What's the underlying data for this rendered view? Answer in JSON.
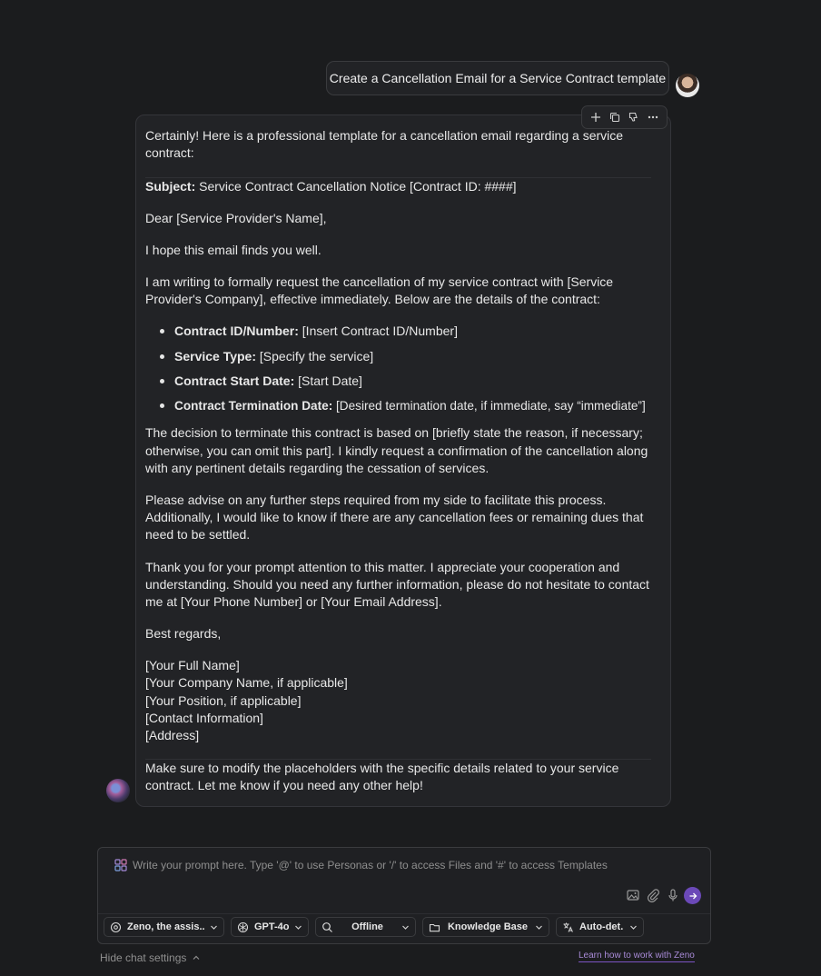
{
  "conversation": {
    "user_message": "Create a Cancellation Email for a Service Contract template",
    "assistant": {
      "intro_1": "Certainly! Here is a professional template for a cancellation email regarding a service",
      "intro_2": "contract:",
      "subject_label": "Subject:",
      "subject_value": "Service Contract Cancellation Notice [Contract ID: ####]",
      "greeting": "Dear [Service Provider's Name],",
      "hope": "I hope this email finds you well.",
      "p1_l1": "I am writing to formally request the cancellation of my service contract with [Service",
      "p1_l2": "Provider's Company], effective immediately. Below are the details of the contract:",
      "bullets": [
        {
          "label": "Contract ID/Number:",
          "value": "[Insert Contract ID/Number]"
        },
        {
          "label": "Service Type:",
          "value": "[Specify the service]"
        },
        {
          "label": "Contract Start Date:",
          "value": "[Start Date]"
        },
        {
          "label": "Contract Termination Date:",
          "value": "[Desired termination date, if immediate, say “immediate”]"
        }
      ],
      "p2_l1": "The decision to terminate this contract is based on [briefly state the reason, if necessary;",
      "p2_l2": "otherwise, you can omit this part]. I kindly request a confirmation of the cancellation along",
      "p2_l3": "with any pertinent details regarding the cessation of services.",
      "p3_l1": "Please advise on any further steps required from my side to facilitate this process.",
      "p3_l2": "Additionally, I would like to know if there are any cancellation fees or remaining dues that",
      "p3_l3": "need to be settled.",
      "p4_l1": "Thank you for your prompt attention to this matter. I appreciate your cooperation and",
      "p4_l2": "understanding. Should you need any further information, please do not hesitate to contact",
      "p4_l3": "me at [Your Phone Number] or [Your Email Address].",
      "closing": "Best regards,",
      "signature": [
        "[Your Full Name]",
        "[Your Company Name, if applicable]",
        "[Your Position, if applicable]",
        "[Contact Information]",
        "[Address]"
      ],
      "footer_l1": "Make sure to modify the placeholders with the specific details related to your service",
      "footer_l2": "contract. Let me know if you need any other help!"
    }
  },
  "message_actions": [
    "plus-icon",
    "copy-icon",
    "thumbs-down-icon",
    "more-icon"
  ],
  "composer": {
    "placeholder": "Write your prompt here. Type '@' to use Personas or '/' to access Files and '#' to access Templates",
    "tools": [
      "image-icon",
      "paperclip-icon",
      "microphone-icon",
      "send-icon"
    ]
  },
  "settings": {
    "persona": "Zeno, the assis...",
    "model": "GPT-4o",
    "search": "Offline",
    "knowledge": "Knowledge Base",
    "language": "Auto-det..."
  },
  "footer": {
    "hide_settings": "Hide chat settings",
    "learn_link": "Learn how to work with Zeno"
  },
  "colors": {
    "background": "#1b1c1e",
    "bubble": "#222326",
    "accent": "#6b49b8",
    "link": "#a98bd8"
  }
}
